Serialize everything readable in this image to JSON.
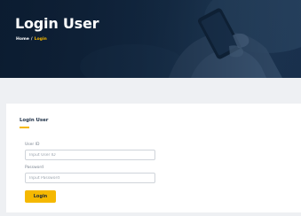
{
  "hero": {
    "title": "Login User",
    "breadcrumb": {
      "home": "Home",
      "separator": "/",
      "current": "Login"
    }
  },
  "form": {
    "heading": "Login User",
    "user_id": {
      "label": "User ID",
      "placeholder": "Input User ID"
    },
    "password": {
      "label": "Password",
      "placeholder": "Input Password"
    },
    "submit_label": "Login"
  },
  "colors": {
    "accent": "#f5b800",
    "hero_dark": "#0d2038",
    "band_grey": "#eef0f3",
    "heading_text": "#1f3147"
  }
}
